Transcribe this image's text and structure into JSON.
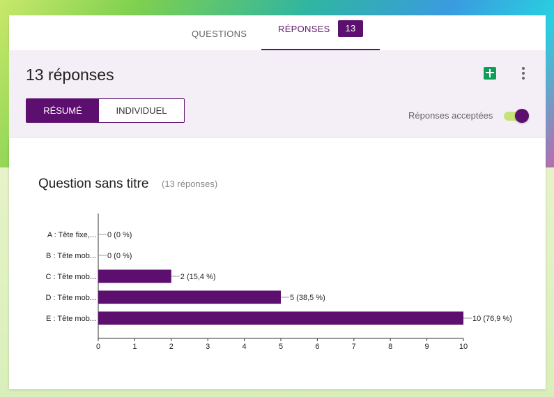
{
  "tabs": {
    "questions_label": "QUESTIONS",
    "responses_label": "RÉPONSES",
    "responses_count": "13"
  },
  "summary": {
    "title": "13 réponses",
    "resume_label": "RÉSUMÉ",
    "individual_label": "INDIVIDUEL",
    "accepting_label": "Réponses acceptées",
    "accepting_on": true,
    "icons": [
      "sheets-icon",
      "more-vert-icon"
    ]
  },
  "question": {
    "title": "Question sans titre",
    "subtitle": "(13 réponses)"
  },
  "colors": {
    "accent": "#5c0f6e",
    "toggle_track": "#c6e37a",
    "sheets": "#0f9d58"
  },
  "chart_data": {
    "type": "bar",
    "orientation": "horizontal",
    "categories": [
      "A : Tête fixe,...",
      "B : Tête mob...",
      "C : Tête mob...",
      "D : Tête mob...",
      "E : Tête mob..."
    ],
    "values": [
      0,
      0,
      2,
      5,
      10
    ],
    "labels": [
      "0 (0 %)",
      "0 (0 %)",
      "2 (15,4 %)",
      "5 (38,5 %)",
      "10 (76,9 %)"
    ],
    "xlim": [
      0,
      10
    ],
    "xticks": [
      "0",
      "1",
      "2",
      "3",
      "4",
      "5",
      "6",
      "7",
      "8",
      "9",
      "10"
    ],
    "bar_color": "#5c0f6e",
    "grid": false
  }
}
